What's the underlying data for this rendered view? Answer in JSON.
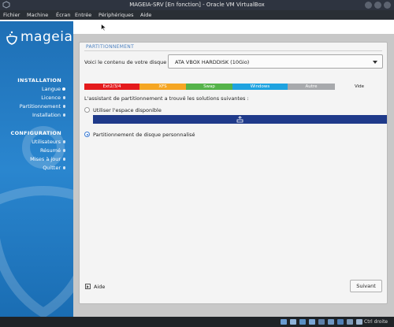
{
  "window": {
    "title": "MAGEIA-SRV [En fonction] - Oracle VM VirtualBox"
  },
  "menubar": [
    "Fichier",
    "Machine",
    "Écran",
    "Entrée",
    "Périphériques",
    "Aide"
  ],
  "sidebar": {
    "logo_text": "mageia",
    "sections": [
      {
        "title": "INSTALLATION",
        "items": [
          {
            "label": "Langue",
            "active": true
          },
          {
            "label": "Licence",
            "active": false
          },
          {
            "label": "Partitionnement",
            "active": false
          },
          {
            "label": "Installation",
            "active": false
          }
        ]
      },
      {
        "title": "CONFIGURATION",
        "items": [
          {
            "label": "Utilisateurs",
            "active": false
          },
          {
            "label": "Résumé",
            "active": false
          },
          {
            "label": "Mises à jour",
            "active": false
          },
          {
            "label": "Quitter",
            "active": false
          }
        ]
      }
    ]
  },
  "main": {
    "section_title": "PARTITIONNEMENT",
    "disk_label": "Voici le contenu de votre disque",
    "disk_select_value": "ATA VBOX HARDDISK (10Gio)",
    "legend": [
      {
        "label": "Ext2/3/4",
        "color": "#e41a1c"
      },
      {
        "label": "XFS",
        "color": "#f5a623"
      },
      {
        "label": "Swap",
        "color": "#55b34a"
      },
      {
        "label": "Windows",
        "color": "#1fa3e0"
      },
      {
        "label": "Autre",
        "color": "#a7a9ac"
      },
      {
        "label": "Vide",
        "color": "#f4f4f4"
      }
    ],
    "assist_text": "L'assistant de partitionnement a trouvé les solutions suivantes :",
    "option_free_space": "Utiliser l'espace disponible",
    "option_custom": "Partitionnement de disque personnalisé",
    "selected_option": "custom",
    "disk_bar_color": "#1f3a8a",
    "help_label": "Aide",
    "next_label": "Suivant"
  },
  "statusbar": {
    "host_key": "Ctrl droite"
  },
  "colors": {
    "sidebar_blue": "#1e6fb5",
    "accent": "#3a7bd5"
  }
}
